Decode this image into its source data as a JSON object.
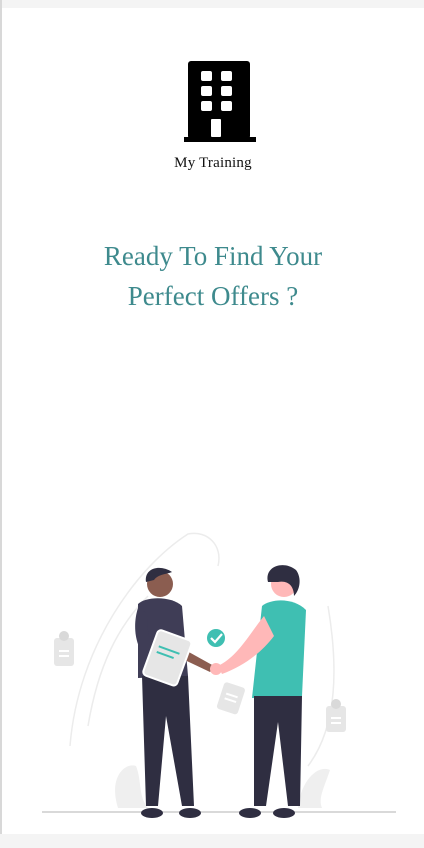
{
  "app": {
    "name": "My Training",
    "logo_icon": "building-icon"
  },
  "hero": {
    "headline_line1": "Ready To Find Your",
    "headline_line2": "Perfect Offers ?"
  },
  "illustration": {
    "name": "handshake-illustration",
    "accent_color": "#3fbfb2",
    "dark_color": "#2f2e41"
  },
  "colors": {
    "headline": "#3e8a8d",
    "background": "#ffffff",
    "page": "#f4f4f4"
  }
}
